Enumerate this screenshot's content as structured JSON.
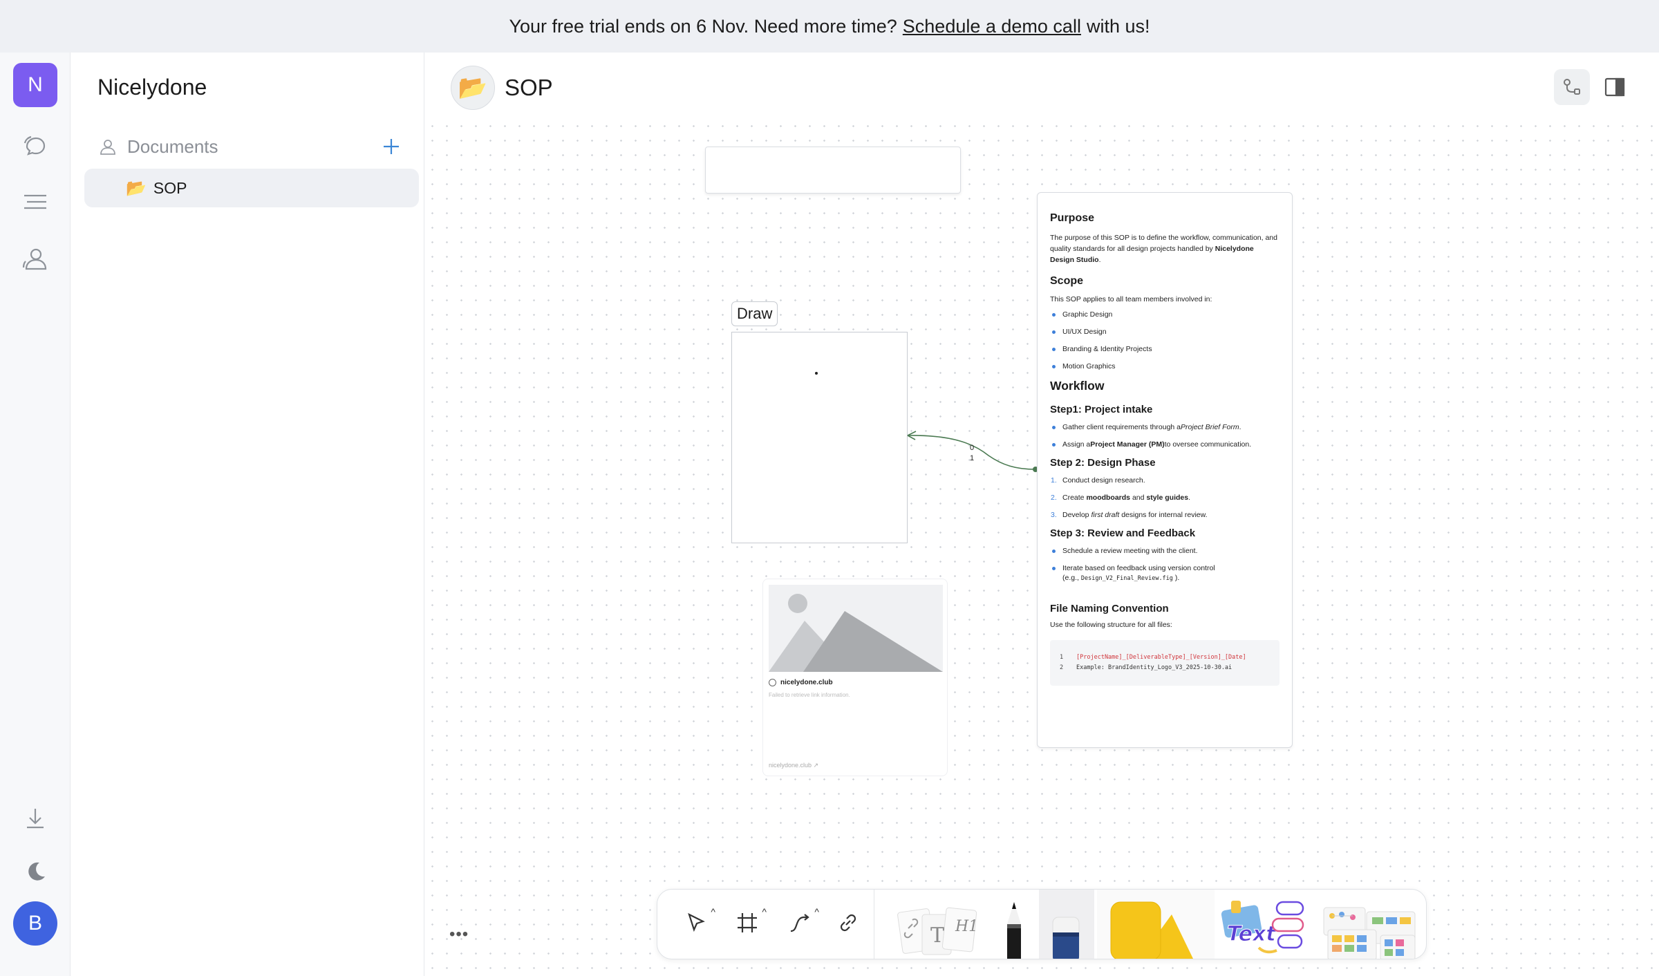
{
  "banner": {
    "text_before": "Your free trial ends on 6 Nov. Need more time?",
    "link": "Schedule a demo call",
    "text_after": "with us!"
  },
  "rail": {
    "workspace_initial": "N",
    "user_initial": "B",
    "icons": [
      "chat-icon",
      "menu-icon",
      "people-icon",
      "download-icon",
      "moon-icon"
    ]
  },
  "sidebar": {
    "workspace_name": "Nicelydone",
    "section_label": "Documents",
    "documents": [
      {
        "icon": "📂",
        "label": "SOP"
      }
    ]
  },
  "header": {
    "icon": "📂",
    "title": "SOP"
  },
  "canvas": {
    "draw_label": "Draw",
    "connector_labels": [
      "0",
      "1"
    ],
    "link_card": {
      "site": "nicelydone.club",
      "error": "Failed to retrieve link information.",
      "footer": "nicelydone.club ↗"
    },
    "doc": {
      "purpose_title": "Purpose",
      "purpose_text": "The purpose of this SOP is to define the workflow, communication, and quality standards for all design projects handled by",
      "purpose_bold": "Nicelydone Design Studio",
      "purpose_end": ".",
      "scope_title": "Scope",
      "scope_text": "This SOP applies to all team members involved in:",
      "scope_items": [
        "Graphic Design",
        "UI/UX Design",
        "Branding & Identity Projects",
        "Motion Graphics"
      ],
      "workflow_title": "Workflow",
      "step1_title": "Step1: Project intake",
      "step1_a_pre": "Gather client requirements through a",
      "step1_a_em": "Project Brief Form",
      "step1_a_post": ".",
      "step1_b_pre": "Assign a",
      "step1_b_bold": "Project Manager (PM)",
      "step1_b_post": "to oversee communication.",
      "step2_title": "Step 2: Design Phase",
      "step2_1": "Conduct design research.",
      "step2_2_pre": "Create",
      "step2_2_b1": "moodboards",
      "step2_2_mid": "and",
      "step2_2_b2": "style guides",
      "step2_2_post": ".",
      "step2_3_pre": "Develop",
      "step2_3_em": "first draft",
      "step2_3_post": "designs for internal review.",
      "step3_title": "Step 3: Review and Feedback",
      "step3_a": "Schedule a review meeting with the client.",
      "step3_b": "Iterate based on feedback using version control",
      "step3_b2_pre": "(e.g.,",
      "step3_b2_code": "Design_V2_Final_Review.fig",
      "step3_b2_post": ").",
      "naming_title": "File Naming Convention",
      "naming_text": "Use the following structure for all files:",
      "code_ln1": "1",
      "code_ln2": "2",
      "code_line1": "[ProjectName]_[DeliverableType]_[Version]_[Date]",
      "code_line2": "Example: BrandIdentity_Logo_V3_2025-10-30.ai"
    }
  },
  "toolbar": {
    "tools": [
      "select-tool",
      "frame-tool",
      "connector-tool",
      "link-tool",
      "text-cards-tool",
      "pen-tool",
      "eraser-tool",
      "shapes-tool",
      "text-stickers-tool",
      "templates-tool"
    ],
    "more": "•••"
  },
  "colors": {
    "workspace_avatar": "#7b5cf0",
    "user_avatar": "#3f63e0",
    "accent": "#3d7fd9",
    "connector": "#4b7a52"
  }
}
